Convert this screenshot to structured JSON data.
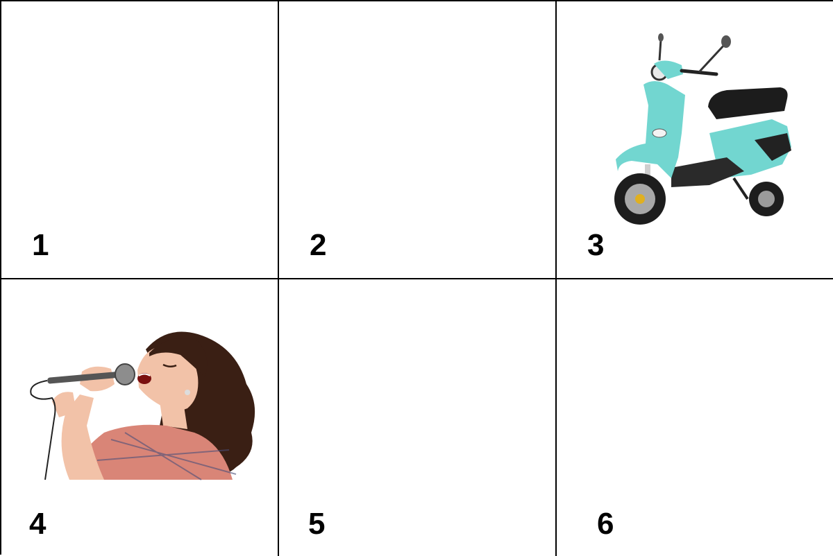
{
  "cells": [
    {
      "number": "1"
    },
    {
      "number": "2"
    },
    {
      "number": "3",
      "picture": "scooter"
    },
    {
      "number": "4",
      "picture": "woman-singing-into-microphone"
    },
    {
      "number": "5"
    },
    {
      "number": "6"
    }
  ],
  "colors": {
    "border": "#000000",
    "scooter_body": "#72d6d0",
    "scooter_seat": "#1c1c1c",
    "hair": "#3a1f14",
    "shirt": "#d98577",
    "skin": "#f2c2a8"
  }
}
